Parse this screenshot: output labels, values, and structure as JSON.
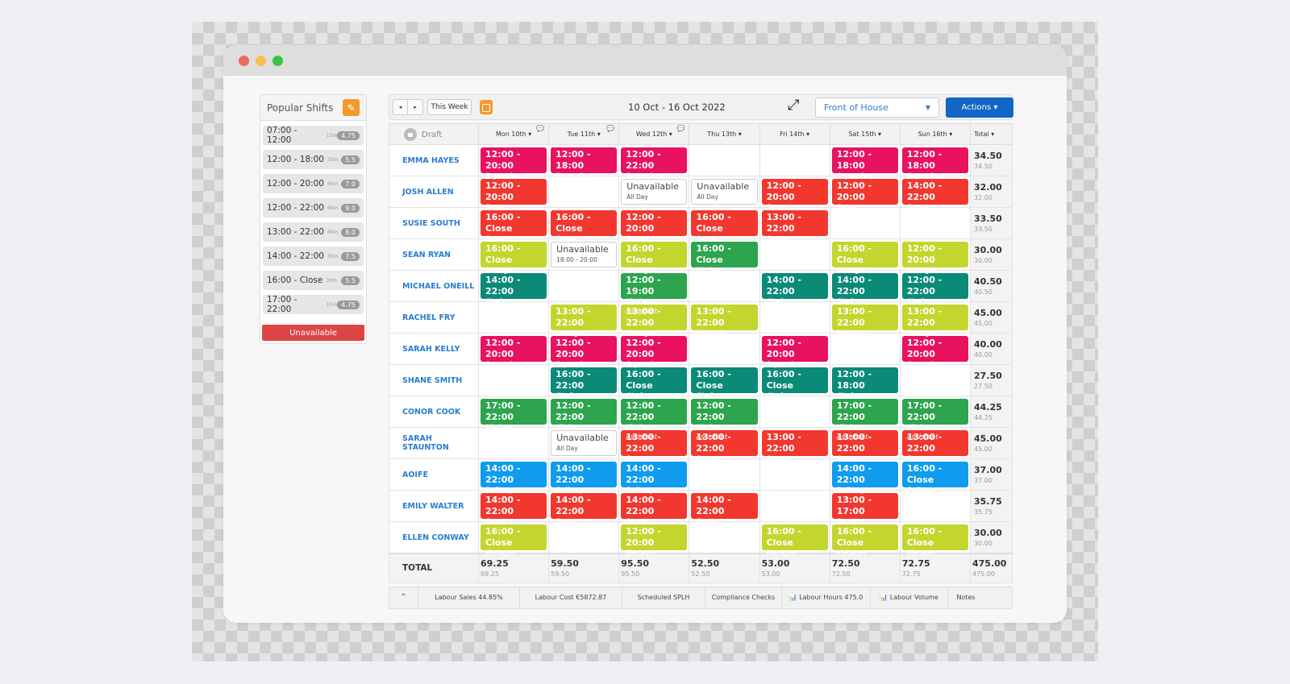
{
  "window": {
    "controls": [
      "close",
      "minimize",
      "maximize"
    ]
  },
  "sidebar": {
    "title": "Popular Shifts",
    "edit_icon": "pencil-icon",
    "shifts": [
      {
        "time": "07:00 - 12:00",
        "break": "15m",
        "hours": "4.75"
      },
      {
        "time": "12:00 - 18:00",
        "break": "30m",
        "hours": "5.5"
      },
      {
        "time": "12:00 - 20:00",
        "break": "60m",
        "hours": "7.0"
      },
      {
        "time": "12:00 - 22:00",
        "break": "60m",
        "hours": "9.0"
      },
      {
        "time": "13:00 - 22:00",
        "break": "60m",
        "hours": "8.0"
      },
      {
        "time": "14:00 - 22:00",
        "break": "30m",
        "hours": "7.5"
      },
      {
        "time": "16:00 - Close",
        "break": "30m",
        "hours": "5.5"
      },
      {
        "time": "17:00 - 22:00",
        "break": "15m",
        "hours": "4.75"
      }
    ],
    "unavailable_label": "Unavailable"
  },
  "toolbar": {
    "prev_icon": "◂",
    "next_icon": "▸",
    "this_week_label": "This Week",
    "date_range": "10 Oct - 16 Oct 2022",
    "expand_icon": "⤢",
    "department": "Front of House",
    "actions_label": "Actions ▾"
  },
  "colors": {
    "Supervisor": "#e8125f",
    "Server": "#f2372f",
    "Manager": "#c2d62e",
    "Kitchen Assistant": "#2da44e",
    "Chef": "#0b8a78",
    "Delivery": "#0f9cef"
  },
  "table": {
    "status_label": "Draft",
    "days": [
      {
        "label": "Mon 10th ▾",
        "comment": true
      },
      {
        "label": "Tue 11th ▾",
        "comment": true
      },
      {
        "label": "Wed 12th ▾",
        "comment": true
      },
      {
        "label": "Thu 13th ▾",
        "comment": false
      },
      {
        "label": "Fri 14th ▾",
        "comment": false
      },
      {
        "label": "Sat 15th ▾",
        "comment": false
      },
      {
        "label": "Sun 16th ▾",
        "comment": false
      }
    ],
    "total_label": "Total ▾",
    "rows": [
      {
        "name": "EMMA HAYES",
        "total": "34.50",
        "sub": "34.50",
        "shifts": [
          {
            "time": "12:00 - 20:00",
            "role": "Supervisor"
          },
          {
            "time": "12:00 - 18:00",
            "role": "Supervisor"
          },
          {
            "time": "12:00 - 22:00",
            "role": "Supervisor"
          },
          null,
          null,
          {
            "time": "12:00 - 18:00",
            "role": "Supervisor"
          },
          {
            "time": "12:00 - 18:00",
            "role": "Supervisor"
          }
        ]
      },
      {
        "name": "JOSH ALLEN",
        "total": "32.00",
        "sub": "32.00",
        "shifts": [
          {
            "time": "12:00 - 20:00",
            "role": "Server"
          },
          null,
          {
            "time": "Unavailable",
            "role": "All Day",
            "unavailable": true
          },
          {
            "time": "Unavailable",
            "role": "All Day",
            "unavailable": true
          },
          {
            "time": "12:00 - 20:00",
            "role": "Server"
          },
          {
            "time": "12:00 - 20:00",
            "role": "Server"
          },
          {
            "time": "14:00 - 22:00",
            "role": "Server"
          }
        ]
      },
      {
        "name": "SUSIE SOUTH",
        "total": "33.50",
        "sub": "33.50",
        "shifts": [
          {
            "time": "16:00 - Close",
            "role": "Server"
          },
          {
            "time": "16:00 - Close",
            "role": "Server"
          },
          {
            "time": "12:00 - 20:00",
            "role": "Server"
          },
          {
            "time": "16:00 - Close",
            "role": "Server"
          },
          {
            "time": "13:00 - 22:00",
            "role": "Server"
          },
          null,
          null
        ]
      },
      {
        "name": "SEAN RYAN",
        "total": "30.00",
        "sub": "30.00",
        "shifts": [
          {
            "time": "16:00 - Close",
            "role": "Manager"
          },
          {
            "time": "Unavailable",
            "role": "18:00 - 20:00",
            "unavailable": true
          },
          {
            "time": "16:00 - Close",
            "role": "Manager"
          },
          {
            "time": "16:00 - Close",
            "role": "Kitchen Assistant"
          },
          null,
          {
            "time": "16:00 - Close",
            "role": "Manager"
          },
          {
            "time": "12:00 - 20:00",
            "role": "Manager"
          }
        ]
      },
      {
        "name": "MICHAEL ONEILL",
        "total": "40.50",
        "sub": "40.50",
        "shifts": [
          {
            "time": "14:00 - 22:00",
            "role": "Chef"
          },
          null,
          {
            "time": "12:00 - 19:00",
            "role": "Kitchen Assistant"
          },
          null,
          {
            "time": "14:00 - 22:00",
            "role": "Chef"
          },
          {
            "time": "14:00 - 22:00",
            "role": "Chef"
          },
          {
            "time": "12:00 - 22:00",
            "role": "Chef"
          }
        ]
      },
      {
        "name": "RACHEL FRY",
        "total": "45.00",
        "sub": "45.00",
        "shifts": [
          null,
          {
            "time": "13:00 - 22:00",
            "role": "Manager"
          },
          {
            "time": "13:00 - 22:00",
            "role": "Manager"
          },
          {
            "time": "13:00 - 22:00",
            "role": "Manager"
          },
          null,
          {
            "time": "13:00 - 22:00",
            "role": "Manager"
          },
          {
            "time": "13:00 - 22:00",
            "role": "Manager"
          }
        ]
      },
      {
        "name": "SARAH KELLY",
        "total": "40.00",
        "sub": "40.00",
        "shifts": [
          {
            "time": "12:00 - 20:00",
            "role": "Supervisor"
          },
          {
            "time": "12:00 - 20:00",
            "role": "Supervisor"
          },
          {
            "time": "12:00 - 20:00",
            "role": "Supervisor"
          },
          null,
          {
            "time": "12:00 - 20:00",
            "role": "Supervisor"
          },
          null,
          {
            "time": "12:00 - 20:00",
            "role": "Supervisor"
          }
        ]
      },
      {
        "name": "SHANE SMITH",
        "total": "27.50",
        "sub": "27.50",
        "shifts": [
          null,
          {
            "time": "16:00 - 22:00",
            "role": "Chef"
          },
          {
            "time": "16:00 - Close",
            "role": "Chef"
          },
          {
            "time": "16:00 - Close",
            "role": "Chef"
          },
          {
            "time": "16:00 - Close",
            "role": "Chef"
          },
          {
            "time": "12:00 - 18:00",
            "role": "Chef"
          },
          null
        ]
      },
      {
        "name": "CONOR COOK",
        "total": "44.25",
        "sub": "44.25",
        "shifts": [
          {
            "time": "17:00 - 22:00",
            "role": "Kitchen Assistant"
          },
          {
            "time": "12:00 - 22:00",
            "role": "Kitchen Assistant"
          },
          {
            "time": "12:00 - 22:00",
            "role": "Kitchen Assistant"
          },
          {
            "time": "12:00 - 22:00",
            "role": "Kitchen Assistant"
          },
          null,
          {
            "time": "17:00 - 22:00",
            "role": "Kitchen Assistant"
          },
          {
            "time": "17:00 - 22:00",
            "role": "Kitchen Assistant"
          }
        ]
      },
      {
        "name": "SARAH STAUNTON",
        "total": "45.00",
        "sub": "45.00",
        "shifts": [
          null,
          {
            "time": "Unavailable",
            "role": "All Day",
            "unavailable": true
          },
          {
            "time": "13:00 - 22:00",
            "role": "Server"
          },
          {
            "time": "13:00 - 22:00",
            "role": "Server"
          },
          {
            "time": "13:00 - 22:00",
            "role": "Server"
          },
          {
            "time": "13:00 - 22:00",
            "role": "Server"
          },
          {
            "time": "13:00 - 22:00",
            "role": "Server"
          }
        ]
      },
      {
        "name": "AOIFE",
        "total": "37.00",
        "sub": "37.00",
        "shifts": [
          {
            "time": "14:00 - 22:00",
            "role": "Delivery"
          },
          {
            "time": "14:00 - 22:00",
            "role": "Delivery"
          },
          {
            "time": "14:00 - 22:00",
            "role": "Delivery"
          },
          null,
          null,
          {
            "time": "14:00 - 22:00",
            "role": "Delivery"
          },
          {
            "time": "16:00 - Close",
            "role": "Delivery"
          }
        ]
      },
      {
        "name": "EMILY WALTER",
        "total": "35.75",
        "sub": "35.75",
        "shifts": [
          {
            "time": "14:00 - 22:00",
            "role": "Server"
          },
          {
            "time": "14:00 - 22:00",
            "role": "Server"
          },
          {
            "time": "14:00 - 22:00",
            "role": "Server"
          },
          {
            "time": "14:00 - 22:00",
            "role": "Server"
          },
          null,
          {
            "time": "13:00 - 17:00",
            "role": "Server"
          },
          null
        ]
      },
      {
        "name": "ELLEN CONWAY",
        "total": "30.00",
        "sub": "30.00",
        "shifts": [
          {
            "time": "16:00 - Close",
            "role": "Manager"
          },
          null,
          {
            "time": "12:00 - 20:00",
            "role": "Manager"
          },
          null,
          {
            "time": "16:00 - Close",
            "role": "Manager"
          },
          {
            "time": "16:00 - Close",
            "role": "Manager"
          },
          {
            "time": "16:00 - Close",
            "role": "Manager"
          }
        ]
      }
    ],
    "totals": {
      "label": "TOTAL",
      "days": [
        {
          "main": "69.25",
          "sub": "69.25"
        },
        {
          "main": "59.50",
          "sub": "59.50"
        },
        {
          "main": "95.50",
          "sub": "95.50"
        },
        {
          "main": "52.50",
          "sub": "52.50"
        },
        {
          "main": "53.00",
          "sub": "53.00"
        },
        {
          "main": "72.50",
          "sub": "72.50"
        },
        {
          "main": "72.75",
          "sub": "72.75"
        }
      ],
      "grand": {
        "main": "475.00",
        "sub": "475.00"
      }
    }
  },
  "footer": {
    "collapse_icon": "⌃",
    "items": [
      "Labour Sales 44.85%",
      "Labour Cost €5872.87",
      "Scheduled SPLH",
      "Compliance Checks",
      "📊 Labour Hours 475.0",
      "📊 Labour Volume",
      "Notes"
    ]
  }
}
